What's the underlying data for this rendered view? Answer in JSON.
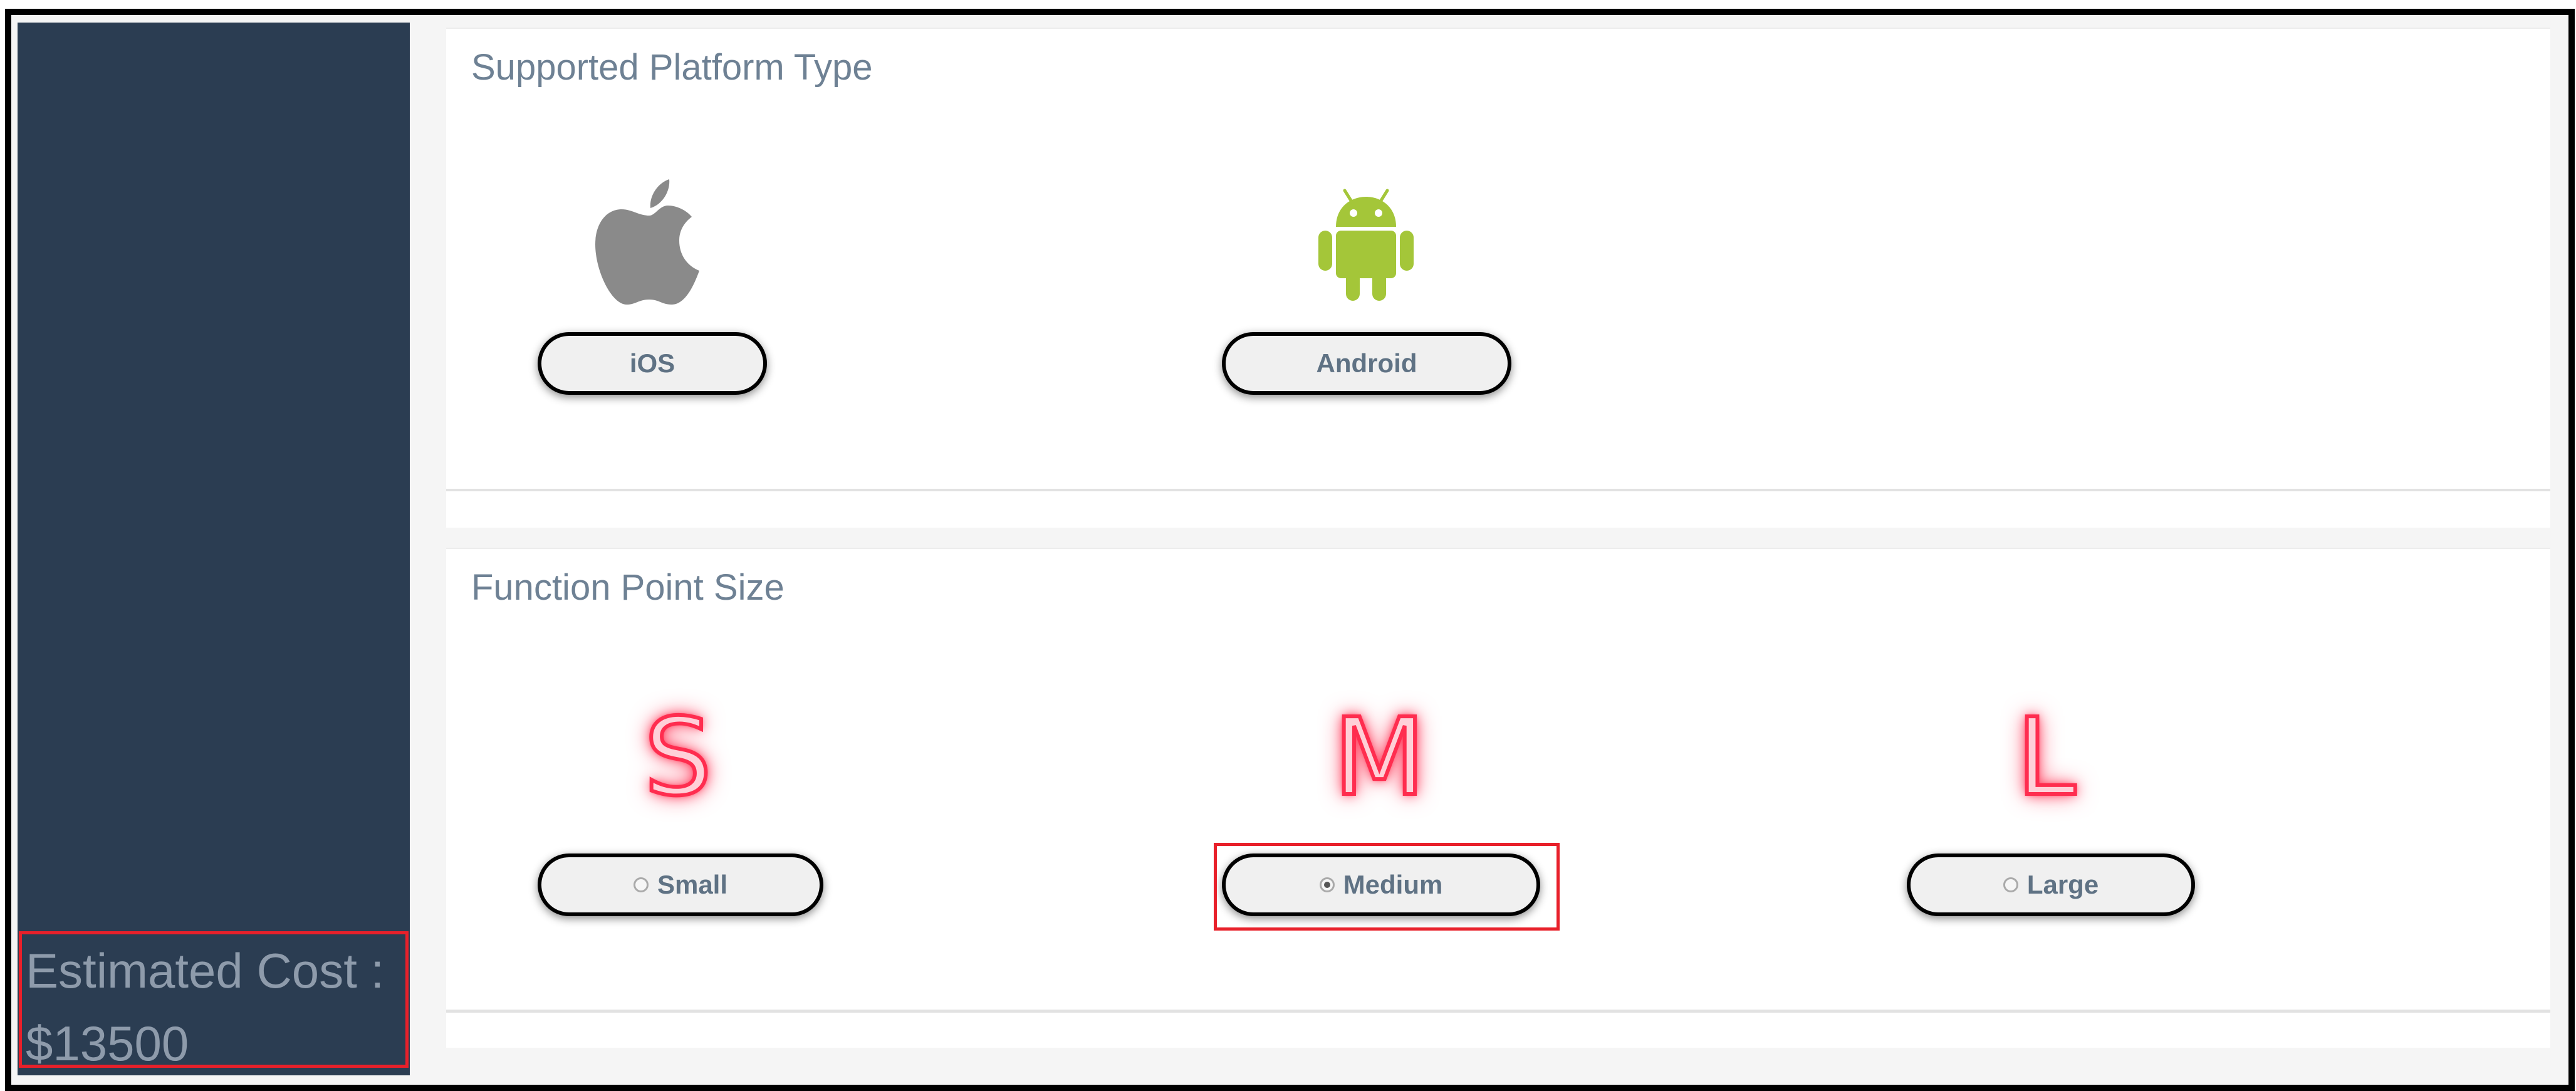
{
  "sidebar": {
    "estimated_cost_label": "Estimated Cost :",
    "estimated_cost_value": "$13500"
  },
  "platform_section": {
    "title": "Supported Platform Type",
    "options": [
      {
        "label": "iOS",
        "icon": "apple-icon"
      },
      {
        "label": "Android",
        "icon": "android-icon"
      }
    ]
  },
  "function_point_section": {
    "title": "Function Point Size",
    "options": [
      {
        "letter": "S",
        "label": "Small",
        "selected": false
      },
      {
        "letter": "M",
        "label": "Medium",
        "selected": true
      },
      {
        "letter": "L",
        "label": "Large",
        "selected": false
      }
    ]
  },
  "colors": {
    "sidebar_bg": "#2b3d52",
    "title_text": "#6e8194",
    "android_green": "#a4c639",
    "apple_gray": "#8a8a8a",
    "neon_red": "#ff2d4f",
    "highlight_red": "#e8202a"
  }
}
